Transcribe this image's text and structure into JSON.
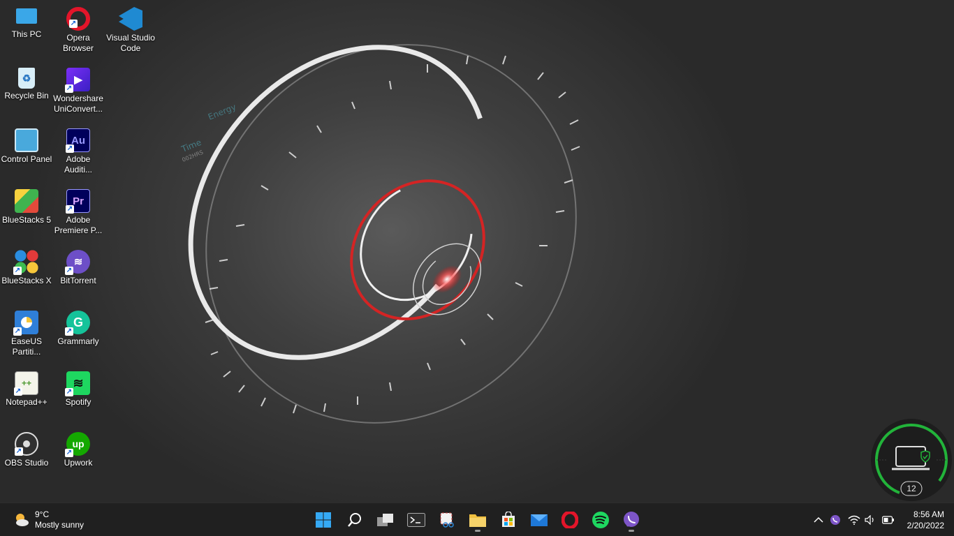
{
  "desktop": {
    "icons": [
      {
        "label": "This PC",
        "icon": "monitor-icon"
      },
      {
        "label": "Opera Browser",
        "icon": "opera-icon"
      },
      {
        "label": "Visual Studio Code",
        "icon": "vscode-icon"
      },
      {
        "label": "Recycle Bin",
        "icon": "recycle-bin-icon"
      },
      {
        "label": "Wondershare UniConvert...",
        "icon": "uniconverter-icon"
      },
      {
        "label": "Control Panel",
        "icon": "control-panel-icon"
      },
      {
        "label": "Adobe Auditi...",
        "icon": "audition-icon"
      },
      {
        "label": "BlueStacks 5",
        "icon": "bluestacks-icon"
      },
      {
        "label": "Adobe Premiere P...",
        "icon": "premiere-icon"
      },
      {
        "label": "BlueStacks X",
        "icon": "bluestacks-x-icon"
      },
      {
        "label": "BitTorrent",
        "icon": "bittorrent-icon"
      },
      {
        "label": "EaseUS Partiti...",
        "icon": "easeus-icon"
      },
      {
        "label": "Grammarly",
        "icon": "grammarly-icon"
      },
      {
        "label": "Notepad++",
        "icon": "notepadpp-icon"
      },
      {
        "label": "Spotify",
        "icon": "spotify-icon"
      },
      {
        "label": "OBS Studio",
        "icon": "obs-icon"
      },
      {
        "label": "Upwork",
        "icon": "upwork-icon"
      }
    ],
    "au_text": "Au",
    "pr_text": "Pr"
  },
  "wallpaper": {
    "labels": [
      "Energy",
      "Time",
      "002HRS"
    ]
  },
  "widget": {
    "count": "12",
    "ring_color": "#22b33a"
  },
  "taskbar": {
    "weather": {
      "temp": "9°C",
      "desc": "Mostly sunny"
    },
    "apps": [
      {
        "name": "start-button",
        "icon": "windows-icon"
      },
      {
        "name": "search-button",
        "icon": "search-icon"
      },
      {
        "name": "task-view-button",
        "icon": "task-view-icon"
      },
      {
        "name": "terminal-button",
        "icon": "terminal-icon"
      },
      {
        "name": "snipping-tool-button",
        "icon": "snipping-tool-icon"
      },
      {
        "name": "file-explorer-button",
        "icon": "folder-icon"
      },
      {
        "name": "microsoft-store-button",
        "icon": "store-icon"
      },
      {
        "name": "mail-button",
        "icon": "mail-icon"
      },
      {
        "name": "opera-button",
        "icon": "opera-icon"
      },
      {
        "name": "spotify-button",
        "icon": "spotify-icon"
      },
      {
        "name": "viber-button",
        "icon": "viber-icon"
      }
    ],
    "clock": {
      "time": "8:56 AM",
      "date": "2/20/2022"
    }
  },
  "colors": {
    "accent_red": "#d42424",
    "taskbar_bg": "#202020"
  }
}
